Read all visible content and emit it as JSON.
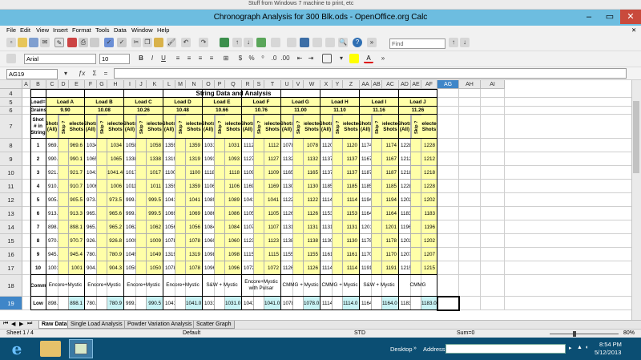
{
  "top_bar": {
    "text": "Stuff from Windows 7 machine to print, etc"
  },
  "window": {
    "title": "Chronograph Analysis for 300 Blk.ods - OpenOffice.org Calc"
  },
  "menu": [
    "File",
    "Edit",
    "View",
    "Insert",
    "Format",
    "Tools",
    "Data",
    "Window",
    "Help"
  ],
  "toolbar": {
    "find_placeholder": "Find",
    "font_name": "Arial",
    "font_size": "10"
  },
  "formula_bar": {
    "cell_ref": "AG19",
    "content": ""
  },
  "columns": [
    "A",
    "B",
    "C",
    "D",
    "E",
    "F",
    "G",
    "H",
    "I",
    "J",
    "K",
    "L",
    "M",
    "N",
    "O",
    "P",
    "Q",
    "R",
    "S",
    "T",
    "U",
    "V",
    "W",
    "X",
    "Y",
    "Z",
    "AA",
    "AB",
    "AC",
    "AD",
    "AE",
    "AF",
    "AG",
    "AH",
    "AI"
  ],
  "sheet": {
    "title": "String Data and Analysis",
    "load_label": "Load=>",
    "grains_label": "Grains=>",
    "shot_label": "Shot # in String",
    "comments_label": "Comments",
    "low_label": "Low",
    "shots_all_label": "Shots (All)",
    "skip_label": "Skip ?",
    "selected_label": "Selected Shots",
    "loads": [
      {
        "name": "Load A",
        "grains": "9.90",
        "comment": "Encore+Mystic",
        "all": [
          "969.6",
          "990.1",
          "921.7",
          "910.7",
          "905.5",
          "913.3",
          "898.1",
          "970.7",
          "945.4",
          "1001.0"
        ],
        "sel": [
          "969.6",
          "990.1",
          "921.7",
          "910.7",
          "905.5",
          "913.3",
          "898.1",
          "970.7",
          "945.4",
          "1001"
        ],
        "low_all": "898.1",
        "low_sel": "898.1"
      },
      {
        "name": "Load B",
        "grains": "10.08",
        "comment": "Encore+Mystic",
        "all": [
          "1034.0",
          "1065.0",
          "1041.4",
          "1006.0",
          "973.5",
          "965.6",
          "965.2",
          "926.8",
          "780.9",
          "904.3"
        ],
        "sel": [
          "1034",
          "1065",
          "1041.4",
          "1006",
          "973.5",
          "965.6",
          "965.2",
          "926.8",
          "780.9",
          "904.3"
        ],
        "low_all": "780.9",
        "low_sel": "780.9"
      },
      {
        "name": "Load C",
        "grains": "10.26",
        "comment": "Encore+Mystic",
        "all": [
          "1058.0",
          "1338.0",
          "1017.0",
          "1011.0",
          "999.5",
          "999.5",
          "1062.0",
          "1009.0",
          "1049.0",
          "1050.0"
        ],
        "sel": [
          "1058",
          "1338",
          "1017",
          "1011",
          "999.5",
          "999.5",
          "1062",
          "1009",
          "1049",
          "1050"
        ],
        "low_all": "999.5",
        "low_sel": "990.5"
      },
      {
        "name": "Load D",
        "grains": "10.48",
        "comment": "Encore+Mystic",
        "all": [
          "1359.0",
          "1319.0",
          "1100.0",
          "1359.0",
          "1041.0",
          "1069.0",
          "1056.0",
          "1078.0",
          "1319.0",
          "1078.0"
        ],
        "sel": [
          "1359",
          "1319",
          "1100",
          "1359",
          "1041",
          "1069",
          "1056",
          "1078",
          "1319",
          "1078"
        ],
        "low_all": "1041.0",
        "low_sel": "1041.0"
      },
      {
        "name": "Load E",
        "grains": "10.66",
        "comment": "S&W + Mystic",
        "all": [
          "1031.0",
          "1093.0",
          "1118.0",
          "1106.0",
          "1089.0",
          "1086.0",
          "1084.0",
          "1060.0",
          "1098.0",
          "1096.0"
        ],
        "sel": [
          "1031",
          "1093",
          "1118",
          "1106",
          "1089",
          "1086",
          "1084",
          "1060",
          "1098",
          "1096"
        ],
        "low_all": "1031.0",
        "low_sel": "1031.0"
      },
      {
        "name": "Load F",
        "grains": "10.76",
        "comment": "Encore+Mystic with Pulsar",
        "all": [
          "1112.0",
          "1127.0",
          "1109.0",
          "1169.0",
          "1041.0",
          "1105.0",
          "1107.0",
          "1123.0",
          "1115.0",
          "1072.0"
        ],
        "sel": [
          "1112",
          "1127",
          "1109",
          "1169",
          "1041",
          "1105",
          "1107",
          "1123",
          "1115",
          "1072"
        ],
        "low_all": "1041.0",
        "low_sel": "1041.0"
      },
      {
        "name": "Load G",
        "grains": "11.00",
        "comment": "CMMG + Mystic",
        "all": [
          "1078.0",
          "1132.0",
          "1165.0",
          "1130.0",
          "1122.0",
          "1126.0",
          "1131.0",
          "1138.0",
          "1155.0",
          "1126.0"
        ],
        "sel": [
          "1078",
          "1132",
          "1165",
          "1130",
          "1122",
          "1126",
          "1131",
          "1138",
          "1155",
          "1126"
        ],
        "low_all": "1078.0",
        "low_sel": "1078.0"
      },
      {
        "name": "Load H",
        "grains": "11.10",
        "comment": "CMMG + Mystic",
        "all": [
          "1120.0",
          "1137.0",
          "1137.0",
          "1185.0",
          "1114.0",
          "1153.0",
          "1131.0",
          "1130.0",
          "1161.0",
          "1114.0"
        ],
        "sel": [
          "1120",
          "1137",
          "1137",
          "1185",
          "1114",
          "1153",
          "1131",
          "1130",
          "1161",
          "1114"
        ],
        "low_all": "1114.0",
        "low_sel": "1114.0"
      },
      {
        "name": "Load I",
        "grains": "11.16",
        "comment": "S&W + Mystic",
        "all": [
          "1174.0",
          "1167.0",
          "1187.0",
          "1185.0",
          "1194.0",
          "1164.0",
          "1201.0",
          "1178.0",
          "1170.0",
          "1191.0"
        ],
        "sel": [
          "1174",
          "1167",
          "1187",
          "1185",
          "1194",
          "1164",
          "1201",
          "1178",
          "1170",
          "1191"
        ],
        "low_all": "1164.0",
        "low_sel": "1164.0"
      },
      {
        "name": "Load J",
        "grains": "11.26",
        "comment": "CMMG",
        "all": [
          "1228.0",
          "1212.0",
          "1218.0",
          "1228.0",
          "1202.0",
          "1183.0",
          "1196.0",
          "1202.0",
          "1207.0",
          "1215.0"
        ],
        "sel": [
          "1228",
          "1212",
          "1218",
          "1228",
          "1202",
          "1183",
          "1196",
          "1202",
          "1207",
          "1215"
        ],
        "low_all": "1183.0",
        "low_sel": "1183.0"
      }
    ]
  },
  "sheet_tabs": [
    "Raw Data",
    "Single Load Analysis",
    "Powder Variation Analysis",
    "Scatter Graph"
  ],
  "status": {
    "sheet": "Sheet 1 / 4",
    "style": "Default",
    "mode": "STD",
    "sum": "Sum=0",
    "zoom": "80%"
  },
  "taskbar": {
    "desktop": "Desktop",
    "address": "Address",
    "time": "8:54 PM",
    "date": "5/12/2013"
  },
  "colors": {
    "titlebar": "#6dbde0",
    "yellow_cell": "#ffffa8",
    "cyan_cell": "#c9f3f5",
    "selected_header": "#3f86c8",
    "taskbar": "#0b4e73"
  }
}
